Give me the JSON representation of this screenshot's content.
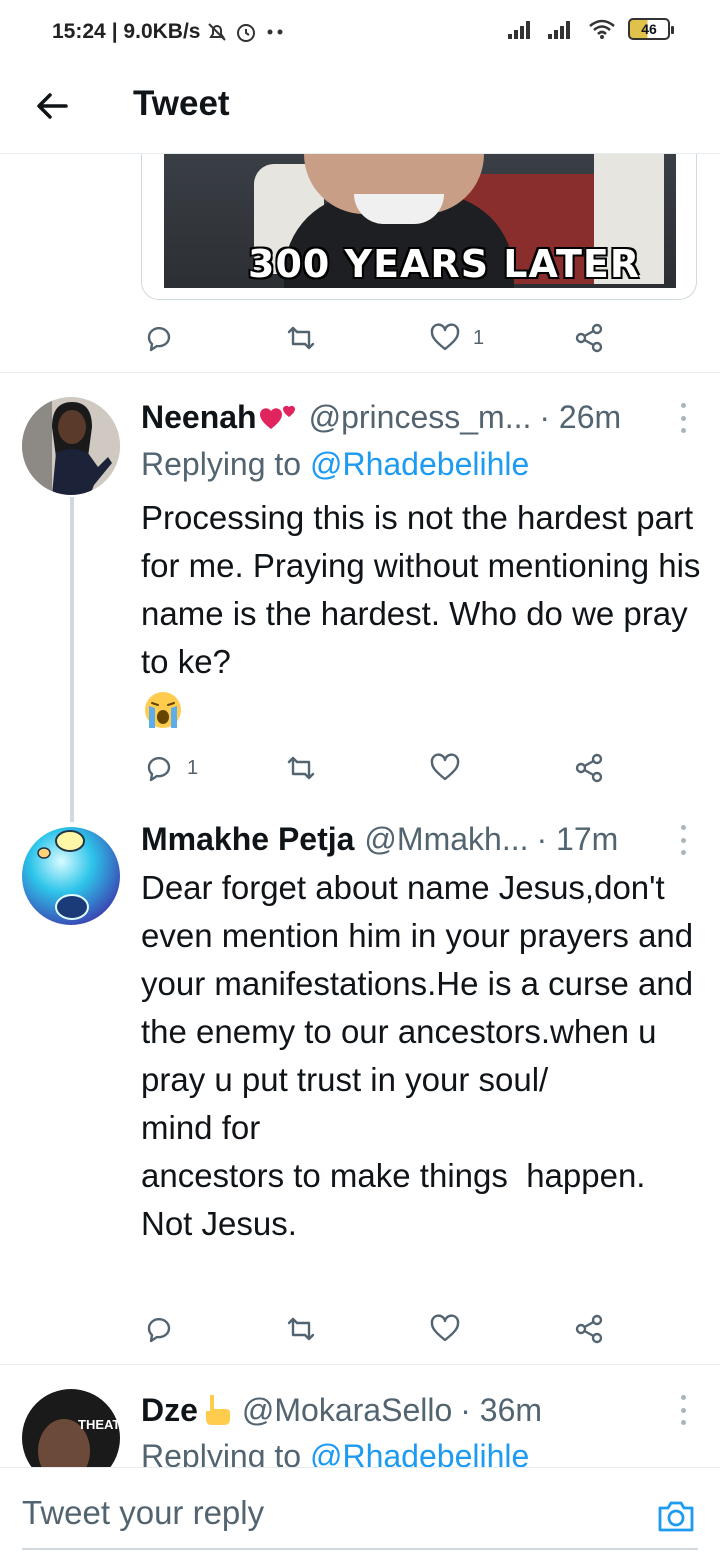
{
  "status_bar": {
    "time": "15:24",
    "net_speed": "| 9.0KB/s",
    "battery": "46",
    "icons": [
      "alarm-off-icon",
      "alarm-icon",
      "more-dots-icon",
      "signal-icon",
      "signal-icon",
      "wifi-icon",
      "battery-icon"
    ]
  },
  "header": {
    "title": "Tweet",
    "back_icon": "arrow-left-icon"
  },
  "media": {
    "caption": "300 YEARS LATER"
  },
  "top_actions": {
    "reply_count": "",
    "retweet_count": "",
    "like_count": "1"
  },
  "tweets": [
    {
      "name": "Neenah",
      "handle": "@princess_m...",
      "time": "· 26m",
      "replying_label": "Replying to",
      "replying_to": "@Rhadebelihle",
      "text": "Processing this is not the hardest part for me. Praying without mentioning his name is the hardest. Who do we pray to ke?",
      "reply_count": "1",
      "retweet_count": "",
      "like_count": ""
    },
    {
      "name": "Mmakhe Petja",
      "handle": "@Mmakh...",
      "time": "· 17m",
      "text": "Dear forget about name Jesus,don't even mention him in your prayers and your manifestations.He is a curse and the enemy to our ancestors.when u pray u put trust in your soul/\nmind for\nancestors to make things  happen.\nNot Jesus.",
      "reply_count": "",
      "retweet_count": "",
      "like_count": ""
    },
    {
      "name": "Dze",
      "handle": "@MokaraSello",
      "time": "· 36m",
      "replying_label": "Replying to",
      "replying_to": "@Rhadebelihle"
    }
  ],
  "avatar_text": {
    "dze_banner": "THEATER"
  },
  "reply_bar": {
    "placeholder": "Tweet your reply",
    "camera_icon": "camera-icon"
  },
  "colors": {
    "accent": "#1d9bf0",
    "secondary_text": "#536471",
    "divider": "#e6ecf0"
  }
}
